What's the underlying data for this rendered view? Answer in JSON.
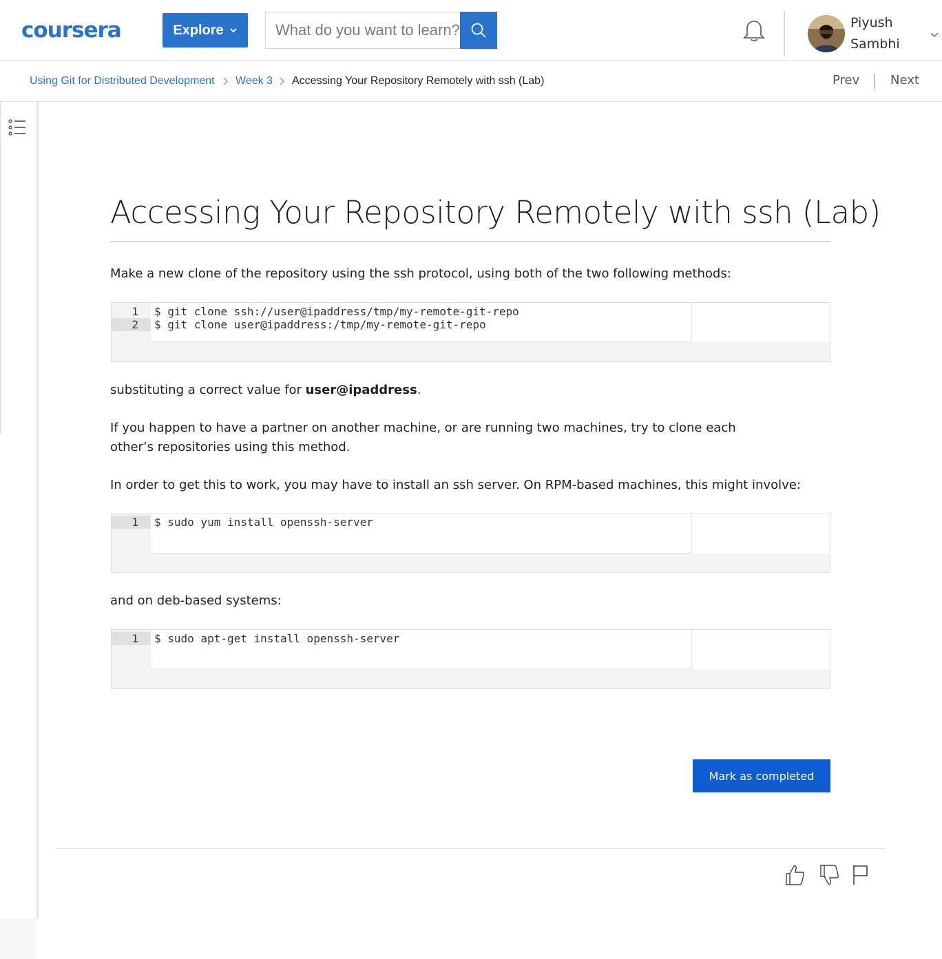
{
  "header": {
    "logo_text": "coursera",
    "explore_label": "Explore",
    "search_placeholder": "What do you want to learn?",
    "user_first": "Piyush",
    "user_last": "Sambhi"
  },
  "breadcrumb": {
    "course": "Using Git for Distributed Development",
    "week": "Week 3",
    "current": "Accessing Your Repository Remotely with ssh (Lab)",
    "prev_label": "Prev",
    "next_label": "Next"
  },
  "content": {
    "title": "Accessing Your Repository Remotely with ssh (Lab)",
    "intro": "Make a new clone of the repository using the ssh protocol, using both of the two following methods:",
    "code1": {
      "lines": [
        {
          "num": "1",
          "text": "$ git clone ssh://user@ipaddress/tmp/my-remote-git-repo"
        },
        {
          "num": "2",
          "text": "$ git clone user@ipaddress:/tmp/my-remote-git-repo"
        }
      ]
    },
    "subst_before": "substituting a correct value for ",
    "subst_bold": "user@ipaddress",
    "subst_after": ".",
    "partner": "If you happen to have a partner on another machine, or are running two machines, try to clone each other’s repositories using this method.",
    "install_intro": "In order to get this to work, you may have to install an ssh server. On RPM-based machines, this might involve:",
    "code2": {
      "lines": [
        {
          "num": "1",
          "text": "$ sudo yum install openssh-server"
        }
      ]
    },
    "deb_intro": "and on deb-based systems:",
    "code3": {
      "lines": [
        {
          "num": "1",
          "text": "$ sudo apt-get install openssh-server"
        }
      ]
    },
    "mark_completed_label": "Mark as completed"
  },
  "icons": {
    "search": "search-icon",
    "bell": "bell-icon",
    "toc": "table-of-contents-icon",
    "like": "thumbs-up-icon",
    "dislike": "thumbs-down-icon",
    "flag": "flag-icon"
  },
  "colors": {
    "brand_blue": "#2a73cc",
    "button_blue": "#0f5bd1",
    "link_blue": "#2a73cc"
  }
}
